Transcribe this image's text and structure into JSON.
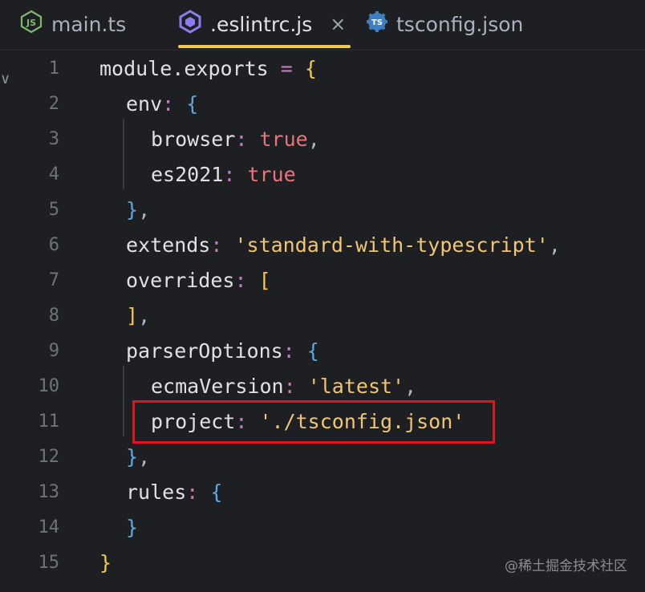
{
  "tabs": [
    {
      "label": "main.ts",
      "icon": "nodejs-icon",
      "active": false
    },
    {
      "label": ".eslintrc.js",
      "icon": "eslint-icon",
      "active": true
    },
    {
      "label": "tsconfig.json",
      "icon": "tsconfig-icon",
      "active": false
    }
  ],
  "close_glyph": "×",
  "lines": [
    {
      "n": "1"
    },
    {
      "n": "2"
    },
    {
      "n": "3"
    },
    {
      "n": "4"
    },
    {
      "n": "5"
    },
    {
      "n": "6"
    },
    {
      "n": "7"
    },
    {
      "n": "8"
    },
    {
      "n": "9"
    },
    {
      "n": "10"
    },
    {
      "n": "11"
    },
    {
      "n": "12"
    },
    {
      "n": "13"
    },
    {
      "n": "14"
    },
    {
      "n": "15"
    }
  ],
  "code": {
    "l1": {
      "a": "module.exports",
      "b": " = ",
      "c": "{"
    },
    "l2": {
      "a": "env",
      "b": ": ",
      "c": "{"
    },
    "l3": {
      "a": "browser",
      "b": ": ",
      "c": "true",
      "d": ","
    },
    "l4": {
      "a": "es2021",
      "b": ": ",
      "c": "true"
    },
    "l5": {
      "a": "}",
      "b": ","
    },
    "l6": {
      "a": "extends",
      "b": ": ",
      "c": "'standard-with-typescript'",
      "d": ","
    },
    "l7": {
      "a": "overrides",
      "b": ": ",
      "c": "["
    },
    "l8": {
      "a": "]",
      "b": ","
    },
    "l9": {
      "a": "parserOptions",
      "b": ": ",
      "c": "{"
    },
    "l10": {
      "a": "ecmaVersion",
      "b": ": ",
      "c": "'latest'",
      "d": ","
    },
    "l11": {
      "a": "project",
      "b": ": ",
      "c": "'./tsconfig.json'"
    },
    "l12": {
      "a": "}",
      "b": ","
    },
    "l13": {
      "a": "rules",
      "b": ": ",
      "c": "{"
    },
    "l14": {
      "a": "}"
    },
    "l15": {
      "a": "}"
    }
  },
  "watermark": "@稀土掘金技术社区",
  "colors": {
    "background": "#1e1f22",
    "accent": "#f2c94c",
    "highlight_box": "#e0161e",
    "string": "#f0c674",
    "boolean": "#e8747c",
    "punctuation": "#c77dbb"
  }
}
